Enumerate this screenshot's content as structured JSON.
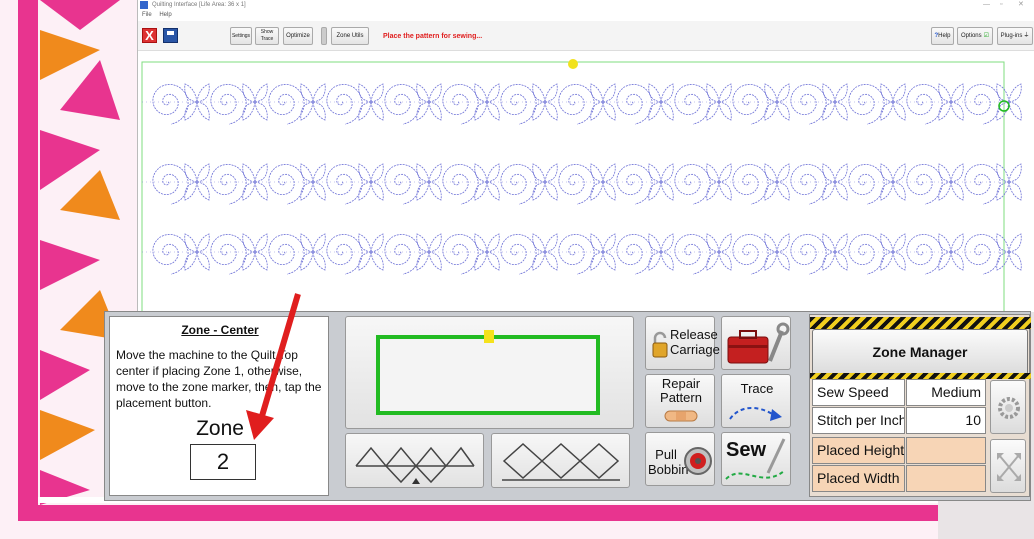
{
  "window": {
    "title": "Quilting Interface   [Life Area: 36 x 1]",
    "menu": [
      "File",
      "Help"
    ]
  },
  "toolbar": {
    "close_label": "X",
    "settings_label": "Settings",
    "show_trace_label": "Show Trace",
    "optimize_label": "Optimize",
    "zone_utils_label": "Zone Utils",
    "status_message": "Place the pattern for sewing...",
    "help_label": "Help",
    "options_label": "Options",
    "plugins_label": "Plug-ins"
  },
  "info_panel": {
    "title": "Zone - Center",
    "text": "Move the machine to the Quilt Top center if placing Zone 1, otherwise, move to the zone marker, then, tap the placement button.",
    "zone_label": "Zone",
    "zone_value": "2"
  },
  "buttons": {
    "release_carriage": "Release Carriage",
    "repair_pattern": "Repair Pattern",
    "trace": "Trace",
    "pull_bobbin": "Pull Bobbin",
    "sew": "Sew"
  },
  "zone_manager": {
    "title": "Zone Manager",
    "rows": [
      {
        "label": "Sew Speed",
        "value": "Medium"
      },
      {
        "label": "Stitch per Inch",
        "value": "10"
      },
      {
        "label": "Placed Height",
        "value": ""
      },
      {
        "label": "Placed Width",
        "value": ""
      }
    ]
  },
  "colors": {
    "status_red": "#e01e1e",
    "pattern_blue": "#6b6fd6",
    "green": "#22bb22",
    "quilt_pink": "#e8348f",
    "quilt_orange": "#f08a1c"
  }
}
